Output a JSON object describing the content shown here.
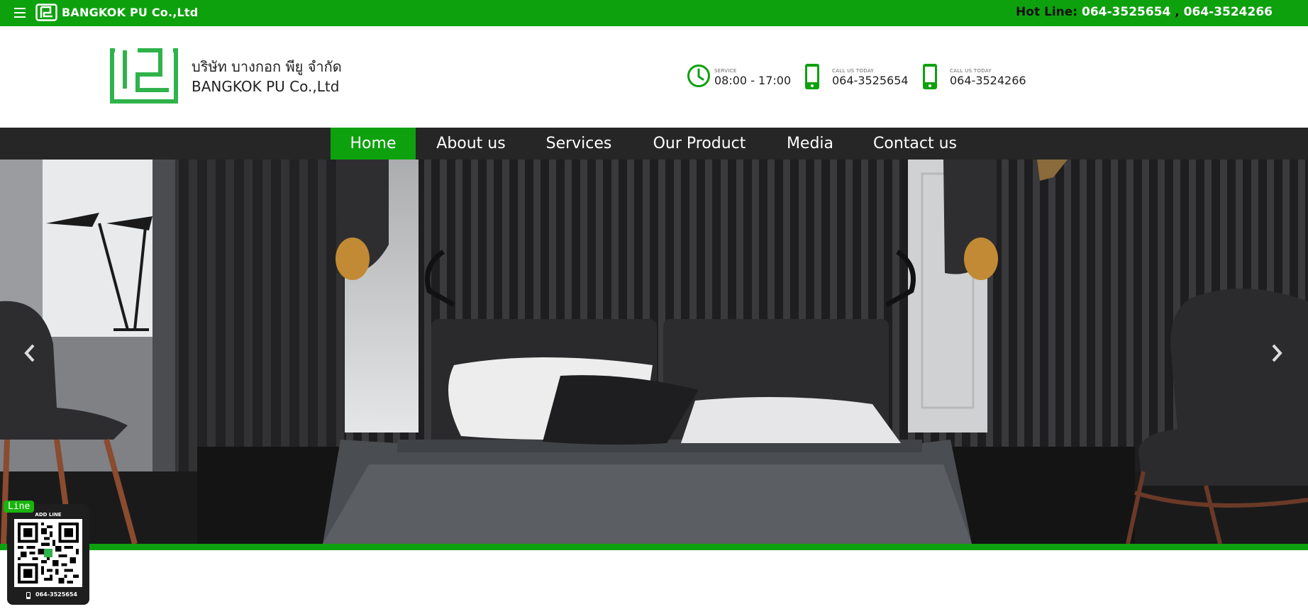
{
  "topbar": {
    "menu_icon": "hamburger-icon",
    "brand": "BANGKOK PU Co.,Ltd",
    "hotline_label": "Hot Line:",
    "hotline_1": "064-3525654",
    "hotline_sep": " , ",
    "hotline_2": "064-3524266"
  },
  "header": {
    "logo_icon": "company-logo",
    "name_th": "บริษัท บางกอก พียู จำกัด",
    "name_en": "BANGKOK PU Co.,Ltd",
    "service_caption": "SERVICE",
    "service_hours": "08:00 - 17:00",
    "call1_caption": "CALL US TODAY",
    "call1_number": "064-3525654",
    "call2_caption": "CALL US TODAY",
    "call2_number": "064-3524266"
  },
  "nav": {
    "items": [
      {
        "label": "Home",
        "active": true
      },
      {
        "label": "About us",
        "active": false
      },
      {
        "label": "Services",
        "active": false
      },
      {
        "label": "Our Product",
        "active": false
      },
      {
        "label": "Media",
        "active": false
      },
      {
        "label": "Contact us",
        "active": false
      }
    ]
  },
  "hero": {
    "prev_icon": "chevron-left-icon",
    "next_icon": "chevron-right-icon",
    "image_subject": "dark modern bedroom"
  },
  "line_widget": {
    "badge": "Line",
    "caption": "ADD LINE",
    "phone": "064-3525654"
  },
  "colors": {
    "brand_green": "#0ea10e",
    "navbar": "#262626"
  }
}
